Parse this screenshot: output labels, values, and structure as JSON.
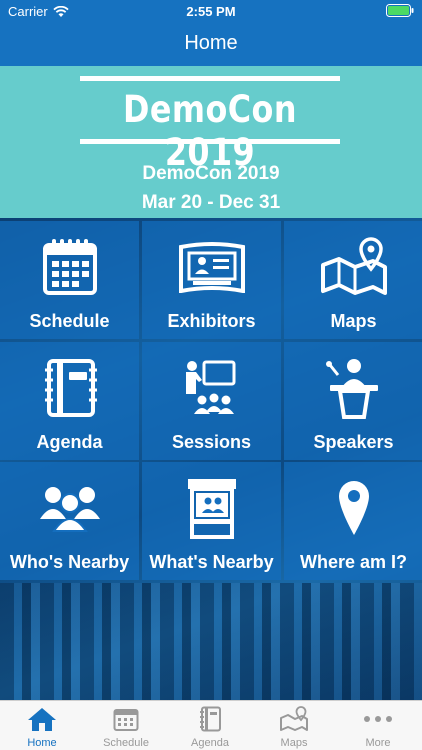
{
  "status_bar": {
    "carrier": "Carrier",
    "time": "2:55 PM"
  },
  "nav": {
    "title": "Home"
  },
  "hero": {
    "logo_text": "DemoCon 2019",
    "event_name": "DemoCon 2019",
    "event_dates": "Mar 20 - Dec 31"
  },
  "tiles": [
    {
      "label": "Schedule",
      "icon": "calendar-icon"
    },
    {
      "label": "Exhibitors",
      "icon": "exhibitor-booth-icon"
    },
    {
      "label": "Maps",
      "icon": "map-icon"
    },
    {
      "label": "Agenda",
      "icon": "notebook-icon"
    },
    {
      "label": "Sessions",
      "icon": "presentation-icon"
    },
    {
      "label": "Speakers",
      "icon": "podium-icon"
    },
    {
      "label": "Who's Nearby",
      "icon": "people-group-icon"
    },
    {
      "label": "What's Nearby",
      "icon": "booth-icon"
    },
    {
      "label": "Where am I?",
      "icon": "location-pin-icon"
    }
  ],
  "tab_bar": {
    "active": "Home",
    "tabs": [
      {
        "label": "Home",
        "icon": "home-icon"
      },
      {
        "label": "Schedule",
        "icon": "calendar-icon"
      },
      {
        "label": "Agenda",
        "icon": "notebook-icon"
      },
      {
        "label": "Maps",
        "icon": "map-icon"
      },
      {
        "label": "More",
        "icon": "more-dots-icon"
      }
    ]
  },
  "colors": {
    "nav": "#1672c0",
    "hero": "#66cccc",
    "tile": "#146ebe",
    "tab_active": "#1672c0",
    "tab_inactive": "#999999"
  }
}
